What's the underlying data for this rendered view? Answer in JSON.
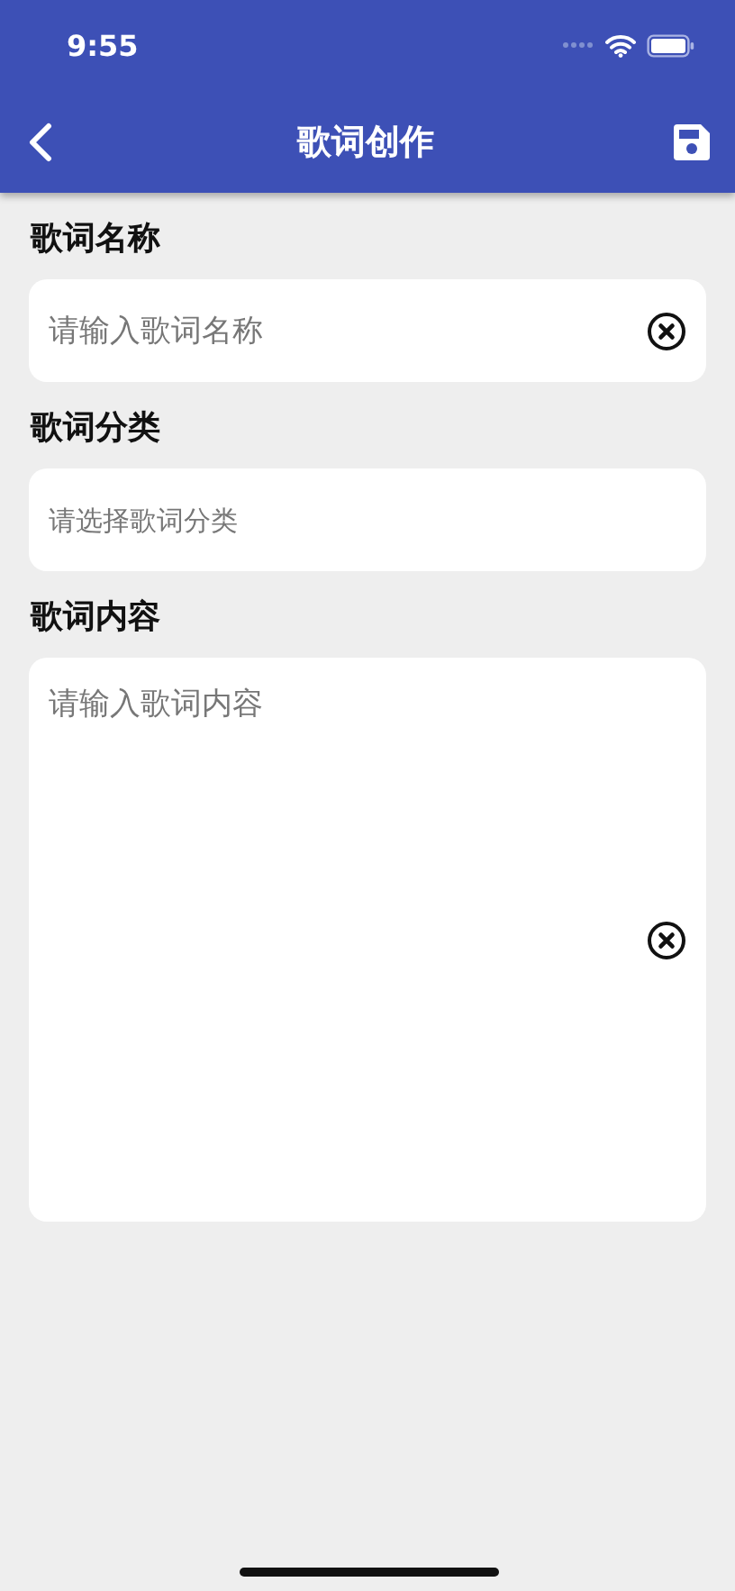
{
  "status_bar": {
    "time": "9:55"
  },
  "nav_bar": {
    "title": "歌词创作"
  },
  "fields": [
    {
      "label": "歌词名称",
      "kind": "input",
      "placeholder": "请输入歌词名称",
      "clearable": true
    },
    {
      "label": "歌词分类",
      "kind": "select",
      "placeholder": "请选择歌词分类",
      "clearable": false
    },
    {
      "label": "歌词内容",
      "kind": "textarea",
      "placeholder": "请输入歌词内容",
      "clearable": true
    }
  ]
}
